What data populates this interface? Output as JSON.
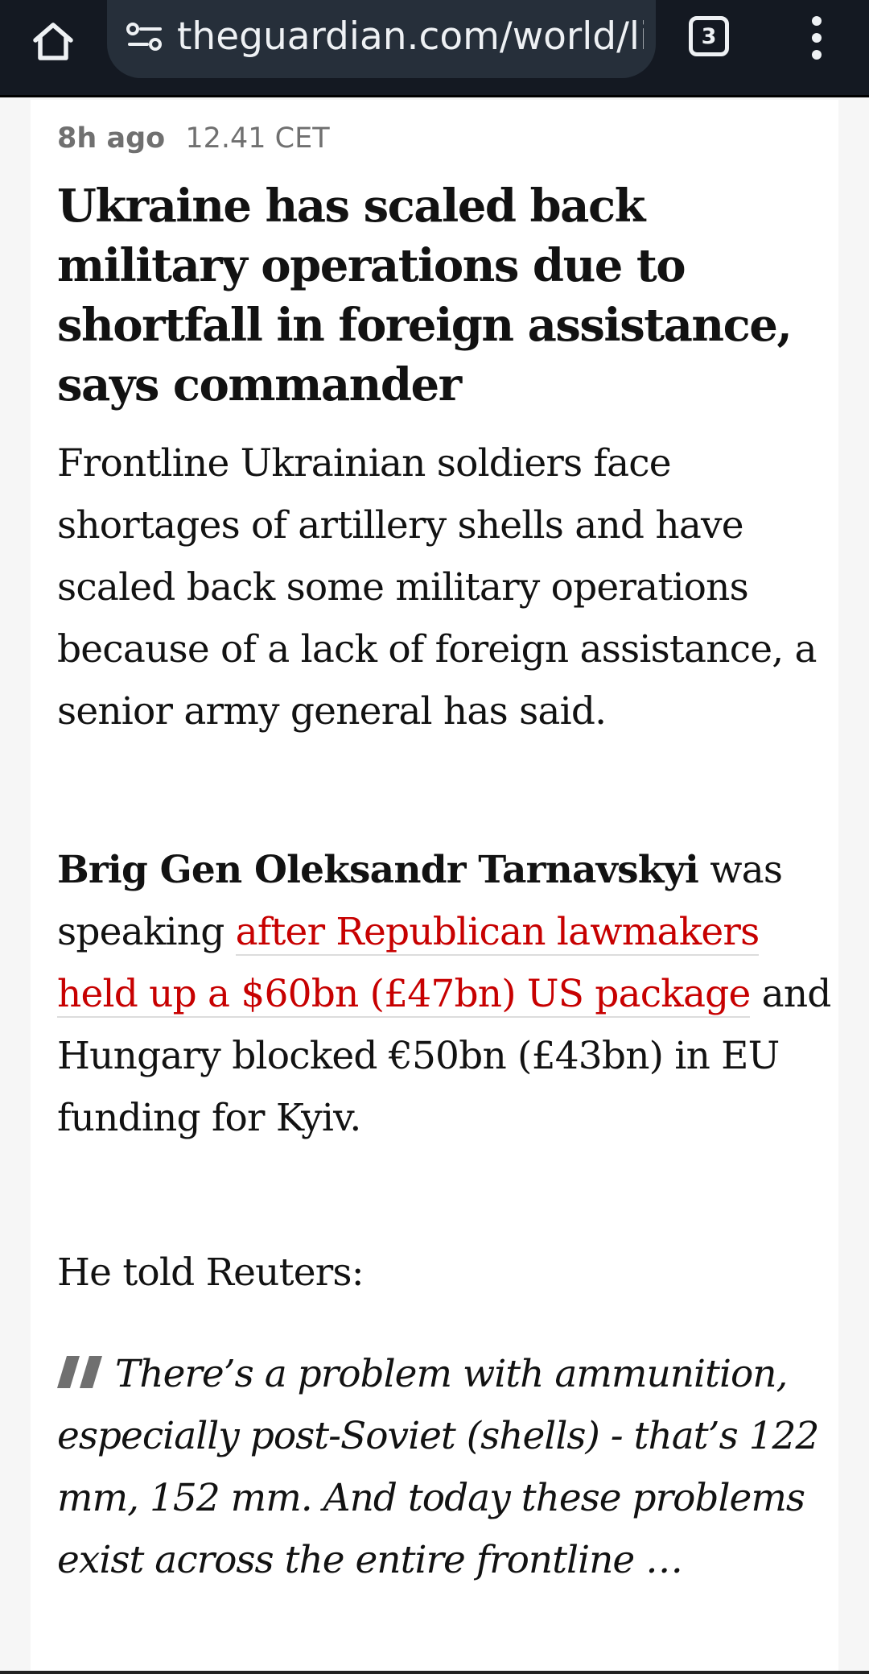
{
  "browser": {
    "url": "theguardian.com/world/li",
    "tab_count": "3"
  },
  "article": {
    "time_ago": "8h ago",
    "timestamp": "12.41 CET",
    "headline": "Ukraine has scaled back military operations due to shortfall in foreign assistance, says commander",
    "standfirst": "Frontline Ukrainian soldiers face shortages of artillery shells and have scaled back some military operations because of a lack of foreign assistance, a senior army general has said.",
    "para1": {
      "name": "Brig Gen Oleksandr Tarnavskyi",
      "text_a": " was speaking ",
      "link": "after Republican lawmakers held up a $60bn (£47bn) US package",
      "text_b": " and Hungary blocked €50bn (£43bn) in EU funding for Kyiv."
    },
    "para2": "He told Reuters:",
    "quote": "There’s a problem with ammunition, especially post-Soviet (shells) - that’s 122 mm, 152 mm. And today these problems exist across the entire frontline …"
  },
  "colors": {
    "toolbar_bg": "#141922",
    "url_pill_bg": "#262f3a",
    "link_red": "#c70000",
    "meta_grey": "#707070"
  }
}
